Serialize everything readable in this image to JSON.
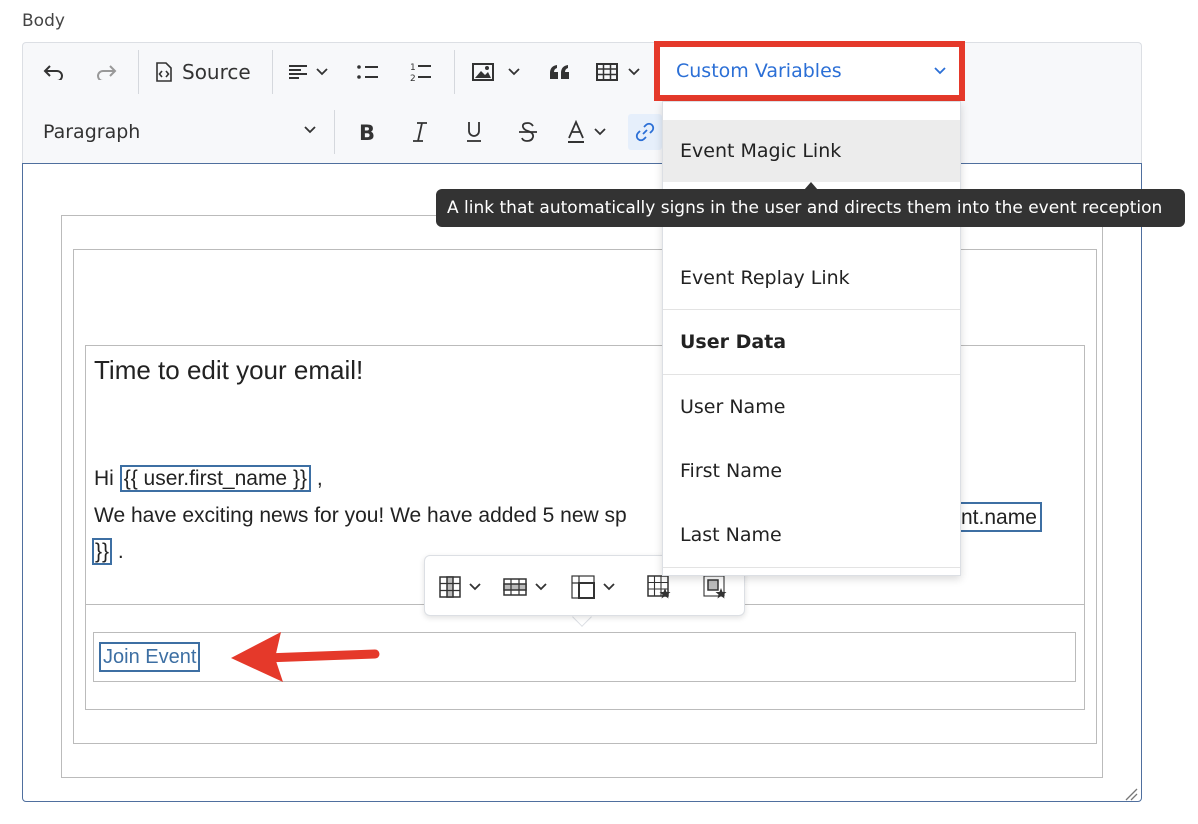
{
  "field": {
    "label": "Body"
  },
  "toolbar": {
    "source_label": "Source",
    "custom_variables_label": "Custom Variables",
    "paragraph_label": "Paragraph",
    "icons": [
      "undo-icon",
      "redo-icon",
      "source-icon",
      "align-icon",
      "bulleted-list-icon",
      "numbered-list-icon",
      "image-icon",
      "quote-icon",
      "table-icon",
      "bold-icon",
      "italic-icon",
      "underline-icon",
      "strikethrough-icon",
      "font-color-icon",
      "link-icon"
    ]
  },
  "dropdown": {
    "items": [
      {
        "label": "Event Magic Link",
        "highlighted": true
      },
      {
        "label": "Event Replay Link"
      },
      {
        "label": "User Data",
        "header": true
      },
      {
        "label": "User Name"
      },
      {
        "label": "First Name"
      },
      {
        "label": "Last Name"
      }
    ]
  },
  "tooltip": {
    "text": "A link that automatically signs in the user and directs them into the event reception"
  },
  "content": {
    "heading": "Time to edit your email!",
    "greeting_prefix": "Hi",
    "first_name_var": "{{ user.first_name }}",
    "greeting_suffix": ",",
    "news_text": "We have exciting news for you! We have added 5 new sp",
    "event_name_var_tail": "nt.name",
    "event_name_var_close": "}}",
    "line3_suffix": ".",
    "join_button": "Join Event"
  },
  "table_toolbar": {
    "icons": [
      "table-column-icon",
      "table-row-icon",
      "merge-cells-icon",
      "table-properties-icon",
      "cell-properties-icon"
    ]
  },
  "colors": {
    "accent_blue": "#2b6fd6",
    "highlight_red": "#e5392a",
    "variable_border": "#3d6fa3",
    "tooltip_bg": "#333333"
  }
}
